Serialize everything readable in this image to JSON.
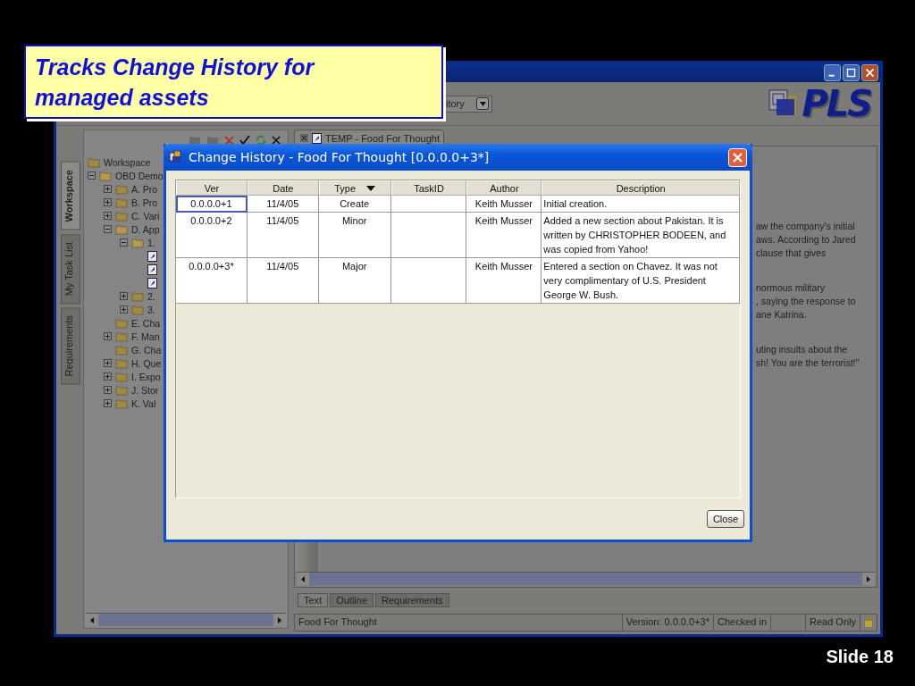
{
  "slide": {
    "callout": "Tracks Change History for managed assets",
    "footer": "Slide 18"
  },
  "app": {
    "combo_value": "itory",
    "logo": "PLS",
    "document_tab": "TEMP - Food For Thought",
    "side_tabs": [
      {
        "label": "Workspace",
        "selected": true
      },
      {
        "label": "My Task List",
        "selected": false
      },
      {
        "label": "Requirements",
        "selected": false
      }
    ],
    "tree": [
      {
        "label": "Workspace",
        "kind": "folder",
        "children": [
          {
            "label": "OBD Demo",
            "kind": "folder",
            "expanded": true,
            "children": [
              {
                "label": "A. Pro",
                "kind": "folder",
                "expanded": false
              },
              {
                "label": "B. Pro",
                "kind": "folder",
                "expanded": false
              },
              {
                "label": "C. Vari",
                "kind": "folder",
                "expanded": false
              },
              {
                "label": "D. App",
                "kind": "folder",
                "expanded": true,
                "children": [
                  {
                    "label": "1.",
                    "kind": "folder",
                    "expanded": true,
                    "children": [
                      {
                        "kind": "document"
                      },
                      {
                        "kind": "document"
                      },
                      {
                        "kind": "document"
                      }
                    ]
                  },
                  {
                    "label": "2.",
                    "kind": "folder",
                    "expanded": false
                  },
                  {
                    "label": "3.",
                    "kind": "folder",
                    "expanded": false
                  }
                ]
              },
              {
                "label": "E. Cha",
                "kind": "folder"
              },
              {
                "label": "F. Man",
                "kind": "folder",
                "expanded": false
              },
              {
                "label": "G. Cha",
                "kind": "folder"
              },
              {
                "label": "H. Que",
                "kind": "folder",
                "expanded": false
              },
              {
                "label": "I. Expo",
                "kind": "folder",
                "expanded": false
              },
              {
                "label": "J. Stor",
                "kind": "folder",
                "expanded": false
              },
              {
                "label": "K. Val",
                "kind": "folder",
                "expanded": false
              }
            ]
          }
        ]
      }
    ],
    "document_paragraphs": [
      [
        "aw the company's initial",
        "aws. According to Jared",
        "clause that gives"
      ],
      [
        "normous military",
        ", saying the response to",
        "ane Katrina."
      ],
      [
        "uting insults about the",
        "sh! You are the terrorist!\""
      ]
    ],
    "view_tabs": [
      {
        "label": "Text",
        "selected": true
      },
      {
        "label": "Outline",
        "selected": false
      },
      {
        "label": "Requirements",
        "selected": false
      }
    ],
    "status_bar": {
      "document": "Food For Thought",
      "version": "Version: 0.0.0.0+3*",
      "state": "Checked in",
      "access": "Read Only"
    }
  },
  "dialog": {
    "title": "Change History - Food For Thought [0.0.0.0+3*]",
    "table": {
      "columns": [
        {
          "label": "Ver",
          "sorted": false
        },
        {
          "label": "Date",
          "sorted": false
        },
        {
          "label": "Type",
          "sorted": true
        },
        {
          "label": "TaskID",
          "sorted": false
        },
        {
          "label": "Author",
          "sorted": false
        },
        {
          "label": "Description",
          "sorted": false
        }
      ],
      "rows": [
        {
          "selected": true,
          "cells": [
            "0.0.0.0+1",
            "11/4/05",
            "Create",
            "",
            "Keith Musser",
            "Initial creation."
          ]
        },
        {
          "selected": false,
          "cells": [
            "0.0.0.0+2",
            "11/4/05",
            "Minor",
            "",
            "Keith Musser",
            "Added a new section about Pakistan.  It is written by CHRISTOPHER BODEEN, and was copied from Yahoo!"
          ]
        },
        {
          "selected": false,
          "cells": [
            "0.0.0.0+3*",
            "11/4/05",
            "Major",
            "",
            "Keith Musser",
            "Entered a section on Chavez.  It was not very complimentary of U.S. President George W. Bush."
          ]
        }
      ]
    },
    "buttons": [
      "Close"
    ]
  }
}
